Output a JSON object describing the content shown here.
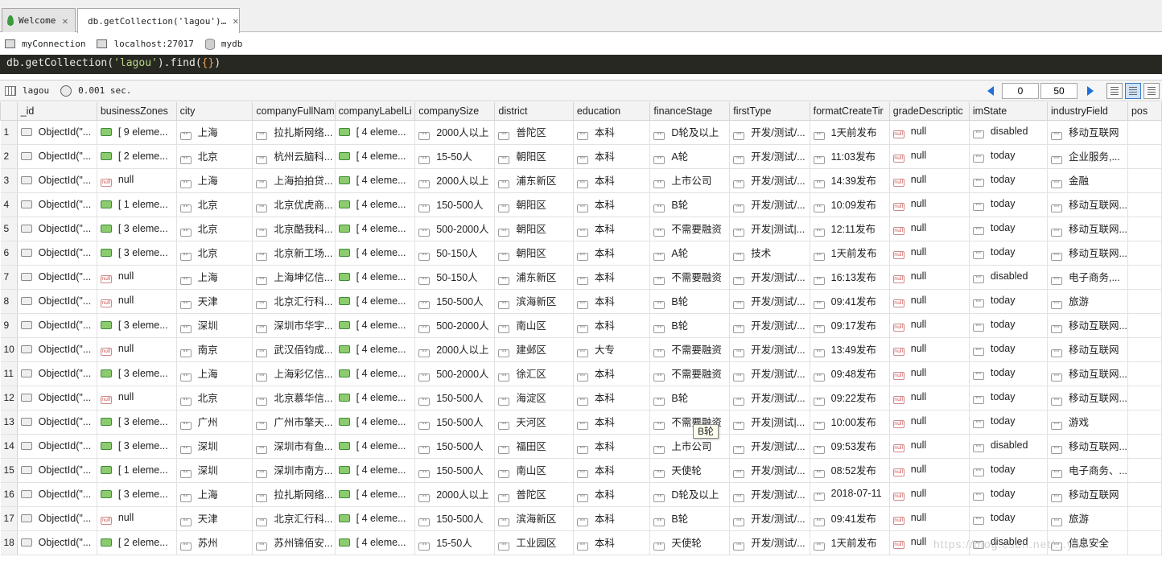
{
  "tabs": [
    {
      "label": "Welcome",
      "active": false
    },
    {
      "label": "db.getCollection('lagou')…",
      "active": true
    }
  ],
  "connection": {
    "name": "myConnection",
    "host": "localhost:27017",
    "db": "mydb"
  },
  "query": {
    "prefix": "db.getCollection(",
    "collection": "'lagou'",
    "mid": ").find(",
    "arg": "{}",
    "suffix": ")"
  },
  "results": {
    "collection": "lagou",
    "time": "0.001 sec.",
    "skip": "0",
    "limit": "50"
  },
  "columns": [
    "_id",
    "businessZones",
    "city",
    "companyFullNam",
    "companyLabelLi",
    "companySize",
    "district",
    "education",
    "financeStage",
    "firstType",
    "formatCreateTir",
    "gradeDescriptic",
    "imState",
    "industryField",
    "pos"
  ],
  "rows": [
    [
      "ObjectId(\"...",
      "[ 9 eleme...",
      "上海",
      "拉扎斯网络...",
      "[ 4 eleme...",
      "2000人以上",
      "普陀区",
      "本科",
      "D轮及以上",
      "开发/测试/...",
      "1天前发布",
      "null",
      "disabled",
      "移动互联网",
      ""
    ],
    [
      "ObjectId(\"...",
      "[ 2 eleme...",
      "北京",
      "杭州云脑科...",
      "[ 4 eleme...",
      "15-50人",
      "朝阳区",
      "本科",
      "A轮",
      "开发/测试/...",
      "11:03发布",
      "null",
      "today",
      "企业服务,...",
      ""
    ],
    [
      "ObjectId(\"...",
      "null",
      "上海",
      "上海拍拍贷...",
      "[ 4 eleme...",
      "2000人以上",
      "浦东新区",
      "本科",
      "上市公司",
      "开发/测试/...",
      "14:39发布",
      "null",
      "today",
      "金融",
      ""
    ],
    [
      "ObjectId(\"...",
      "[ 1 eleme...",
      "北京",
      "北京优虎商...",
      "[ 4 eleme...",
      "150-500人",
      "朝阳区",
      "本科",
      "B轮",
      "开发/测试/...",
      "10:09发布",
      "null",
      "today",
      "移动互联网...",
      ""
    ],
    [
      "ObjectId(\"...",
      "[ 3 eleme...",
      "北京",
      "北京酷我科...",
      "[ 4 eleme...",
      "500-2000人",
      "朝阳区",
      "本科",
      "不需要融资",
      "开发|测试|...",
      "12:11发布",
      "null",
      "today",
      "移动互联网...",
      ""
    ],
    [
      "ObjectId(\"...",
      "[ 3 eleme...",
      "北京",
      "北京新工场...",
      "[ 4 eleme...",
      "50-150人",
      "朝阳区",
      "本科",
      "A轮",
      "技术",
      "1天前发布",
      "null",
      "today",
      "移动互联网...",
      ""
    ],
    [
      "ObjectId(\"...",
      "null",
      "上海",
      "上海坤亿信...",
      "[ 4 eleme...",
      "50-150人",
      "浦东新区",
      "本科",
      "不需要融资",
      "开发/测试/...",
      "16:13发布",
      "null",
      "disabled",
      "电子商务,...",
      ""
    ],
    [
      "ObjectId(\"...",
      "null",
      "天津",
      "北京汇行科...",
      "[ 4 eleme...",
      "150-500人",
      "滨海新区",
      "本科",
      "B轮",
      "开发/测试/...",
      "09:41发布",
      "null",
      "today",
      "旅游",
      ""
    ],
    [
      "ObjectId(\"...",
      "[ 3 eleme...",
      "深圳",
      "深圳市华宇...",
      "[ 4 eleme...",
      "500-2000人",
      "南山区",
      "本科",
      "B轮",
      "开发/测试/...",
      "09:17发布",
      "null",
      "today",
      "移动互联网...",
      ""
    ],
    [
      "ObjectId(\"...",
      "null",
      "南京",
      "武汉佰钧成...",
      "[ 4 eleme...",
      "2000人以上",
      "建邺区",
      "大专",
      "不需要融资",
      "开发/测试/...",
      "13:49发布",
      "null",
      "today",
      "移动互联网",
      ""
    ],
    [
      "ObjectId(\"...",
      "[ 3 eleme...",
      "上海",
      "上海彩亿信...",
      "[ 4 eleme...",
      "500-2000人",
      "徐汇区",
      "本科",
      "不需要融资",
      "开发/测试/...",
      "09:48发布",
      "null",
      "today",
      "移动互联网...",
      ""
    ],
    [
      "ObjectId(\"...",
      "null",
      "北京",
      "北京慕华信...",
      "[ 4 eleme...",
      "150-500人",
      "海淀区",
      "本科",
      "B轮",
      "开发/测试/...",
      "09:22发布",
      "null",
      "today",
      "移动互联网...",
      ""
    ],
    [
      "ObjectId(\"...",
      "[ 3 eleme...",
      "广州",
      "广州市擎天...",
      "[ 4 eleme...",
      "150-500人",
      "天河区",
      "本科",
      "不需要融资",
      "开发|测试|...",
      "10:00发布",
      "null",
      "today",
      "游戏",
      ""
    ],
    [
      "ObjectId(\"...",
      "[ 3 eleme...",
      "深圳",
      "深圳市有鱼...",
      "[ 4 eleme...",
      "150-500人",
      "福田区",
      "本科",
      "上市公司",
      "开发/测试/...",
      "09:53发布",
      "null",
      "disabled",
      "移动互联网...",
      ""
    ],
    [
      "ObjectId(\"...",
      "[ 1 eleme...",
      "深圳",
      "深圳市南方...",
      "[ 4 eleme...",
      "150-500人",
      "南山区",
      "本科",
      "天使轮",
      "开发/测试/...",
      "08:52发布",
      "null",
      "today",
      "电子商务、...",
      ""
    ],
    [
      "ObjectId(\"...",
      "[ 3 eleme...",
      "上海",
      "拉扎斯网络...",
      "[ 4 eleme...",
      "2000人以上",
      "普陀区",
      "本科",
      "D轮及以上",
      "开发/测试/...",
      "2018-07-11",
      "null",
      "today",
      "移动互联网",
      ""
    ],
    [
      "ObjectId(\"...",
      "null",
      "天津",
      "北京汇行科...",
      "[ 4 eleme...",
      "150-500人",
      "滨海新区",
      "本科",
      "B轮",
      "开发/测试/...",
      "09:41发布",
      "null",
      "today",
      "旅游",
      ""
    ],
    [
      "ObjectId(\"...",
      "[ 2 eleme...",
      "苏州",
      "苏州锦佰安...",
      "[ 4 eleme...",
      "15-50人",
      "工业园区",
      "本科",
      "天使轮",
      "开发/测试/...",
      "1天前发布",
      "null",
      "disabled",
      "信息安全",
      ""
    ]
  ],
  "tooltip": "B轮",
  "watermark": "https://blog.csdn.net/...ywi"
}
